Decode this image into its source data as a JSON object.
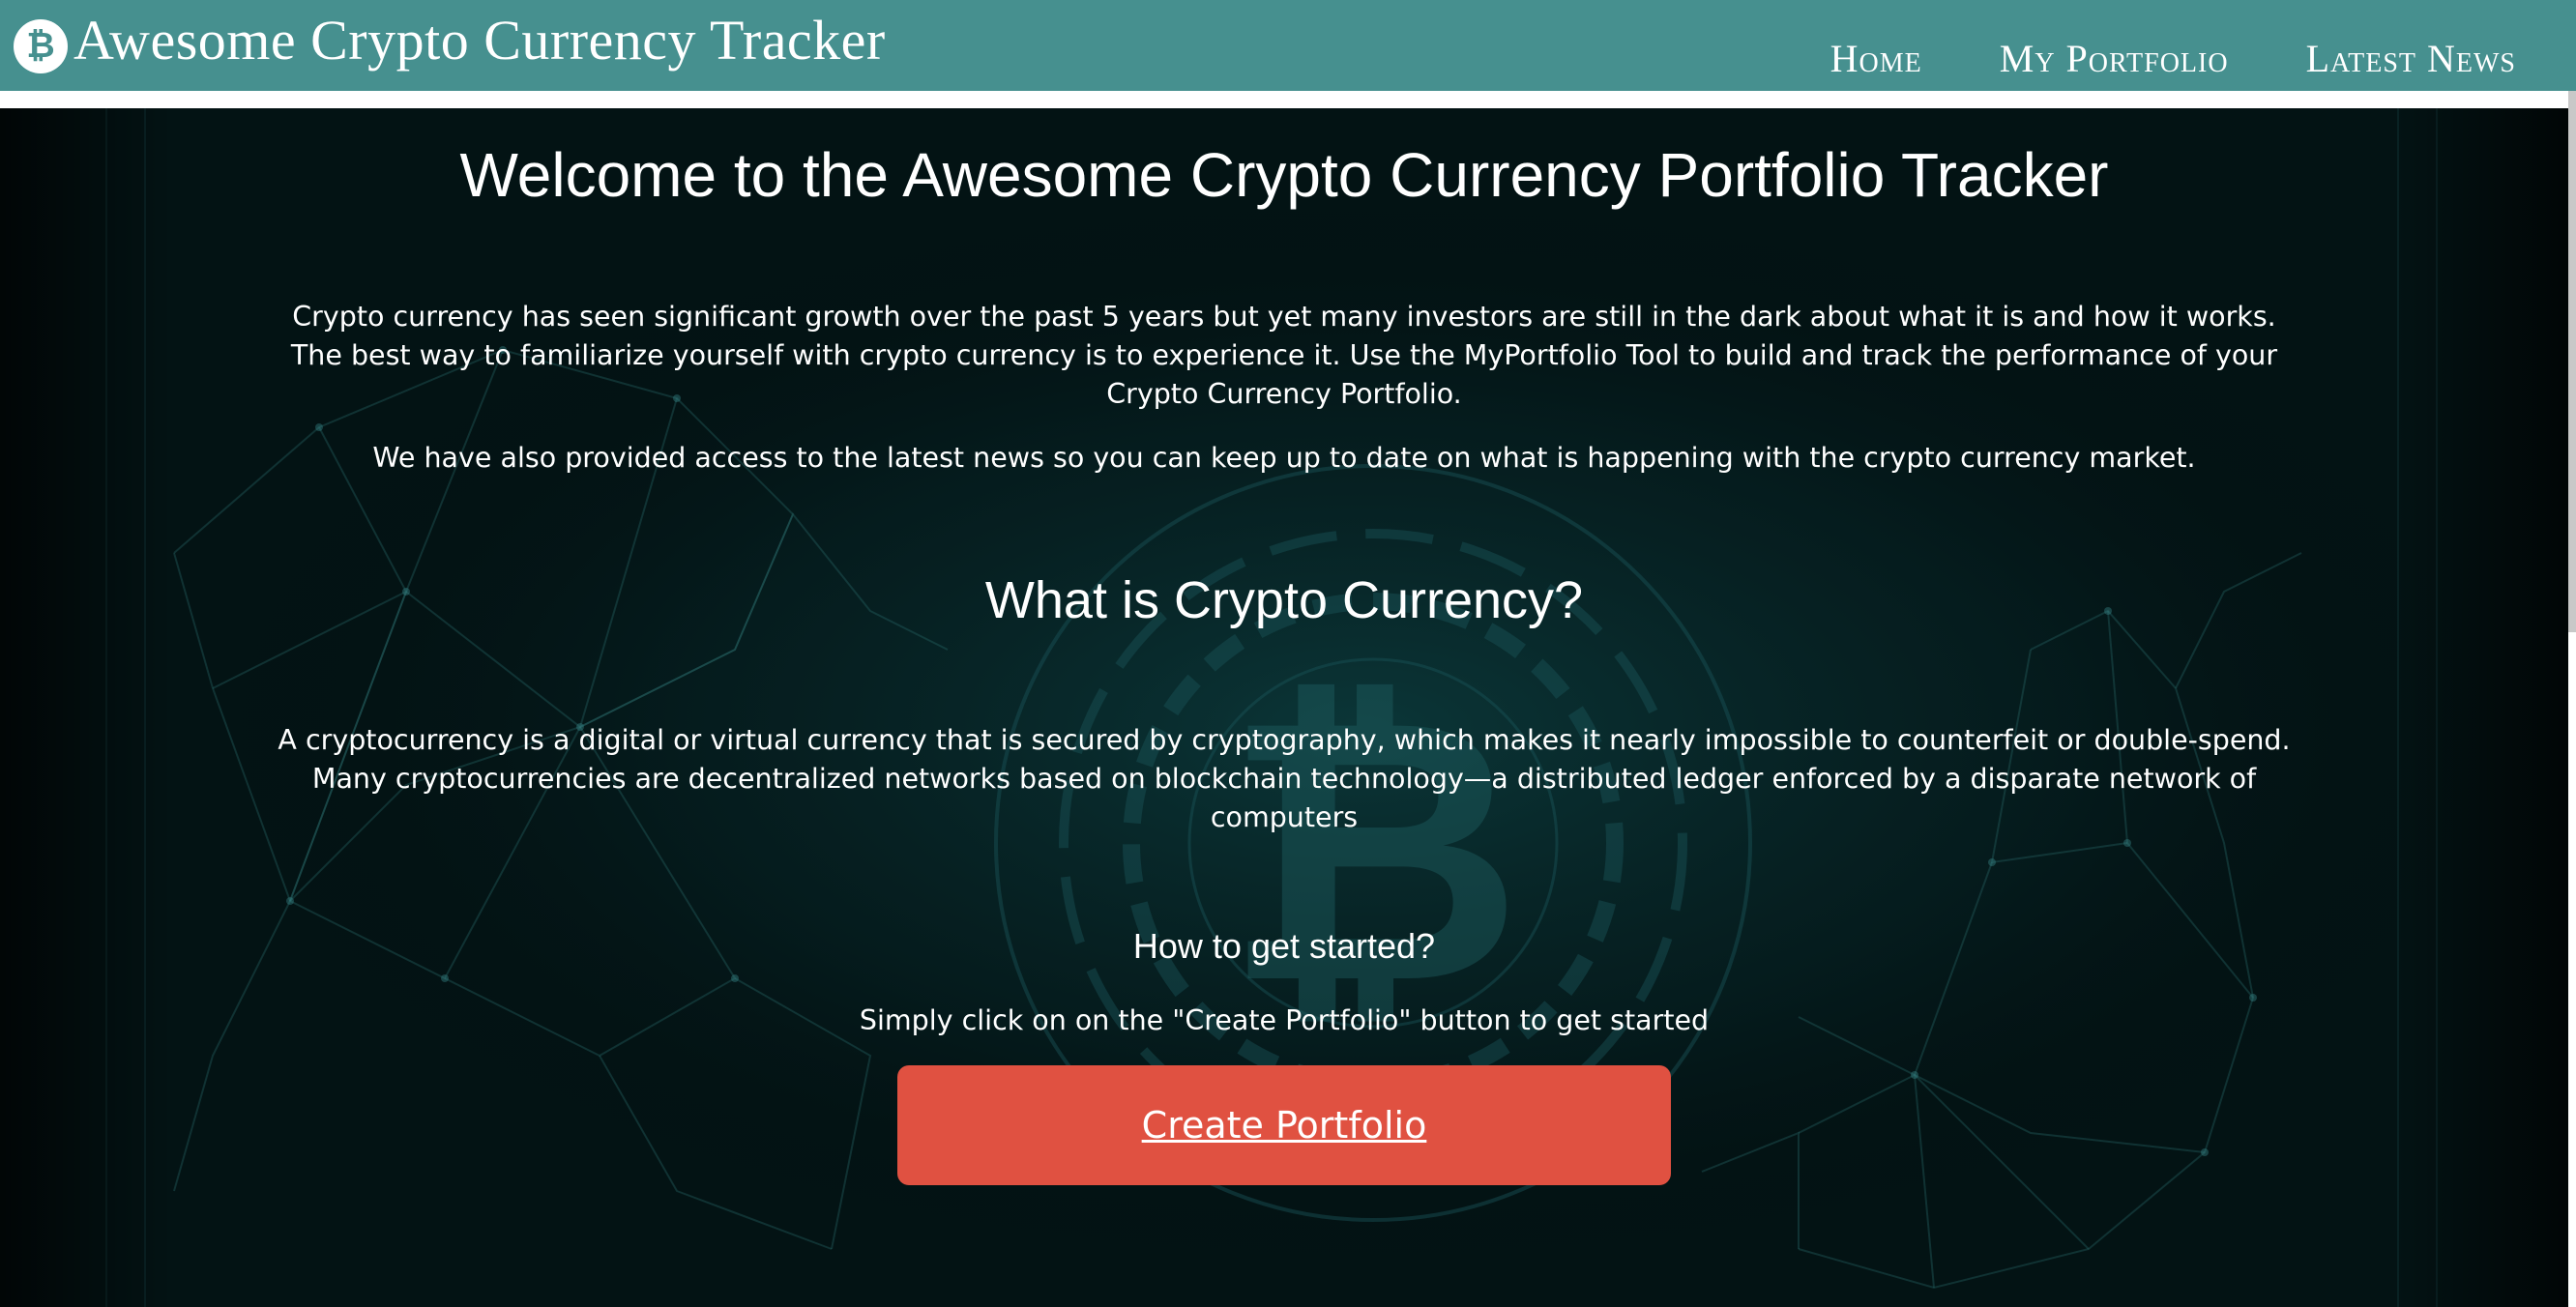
{
  "header": {
    "brand_icon": "bitcoin-icon",
    "brand_icon_glyph": "₿",
    "title": "Awesome Crypto Currency Tracker",
    "nav": [
      {
        "label": "Home"
      },
      {
        "label": "My Portfolio"
      },
      {
        "label": "Latest News"
      }
    ]
  },
  "main": {
    "title": "Welcome to the Awesome Crypto Currency Portfolio Tracker",
    "intro_paragraph": "Crypto currency has seen significant growth over the past 5 years but yet many investors are still in the dark about what it is and how it works. The best way to familiarize yourself with crypto currency is to experience it. Use the MyPortfolio Tool to build and track the performance of your Crypto Currency Portfolio.",
    "news_paragraph": "We have also provided access to the latest news so you can keep up to date on what is happening with the crypto currency market.",
    "section_title": "What is Crypto Currency?",
    "definition": "A cryptocurrency is a digital or virtual currency that is secured by cryptography, which makes it nearly impossible to counterfeit or double-spend. Many cryptocurrencies are decentralized networks based on blockchain technology—a distributed ledger enforced by a disparate network of computers",
    "start_title": "How to get started?",
    "start_text": "Simply click on on the \"Create Portfolio\" button to get started",
    "cta_label": "Create Portfolio"
  },
  "colors": {
    "header": "#46908f",
    "background": "#020c0d",
    "cta": "#e05141",
    "text": "#ffffff"
  }
}
